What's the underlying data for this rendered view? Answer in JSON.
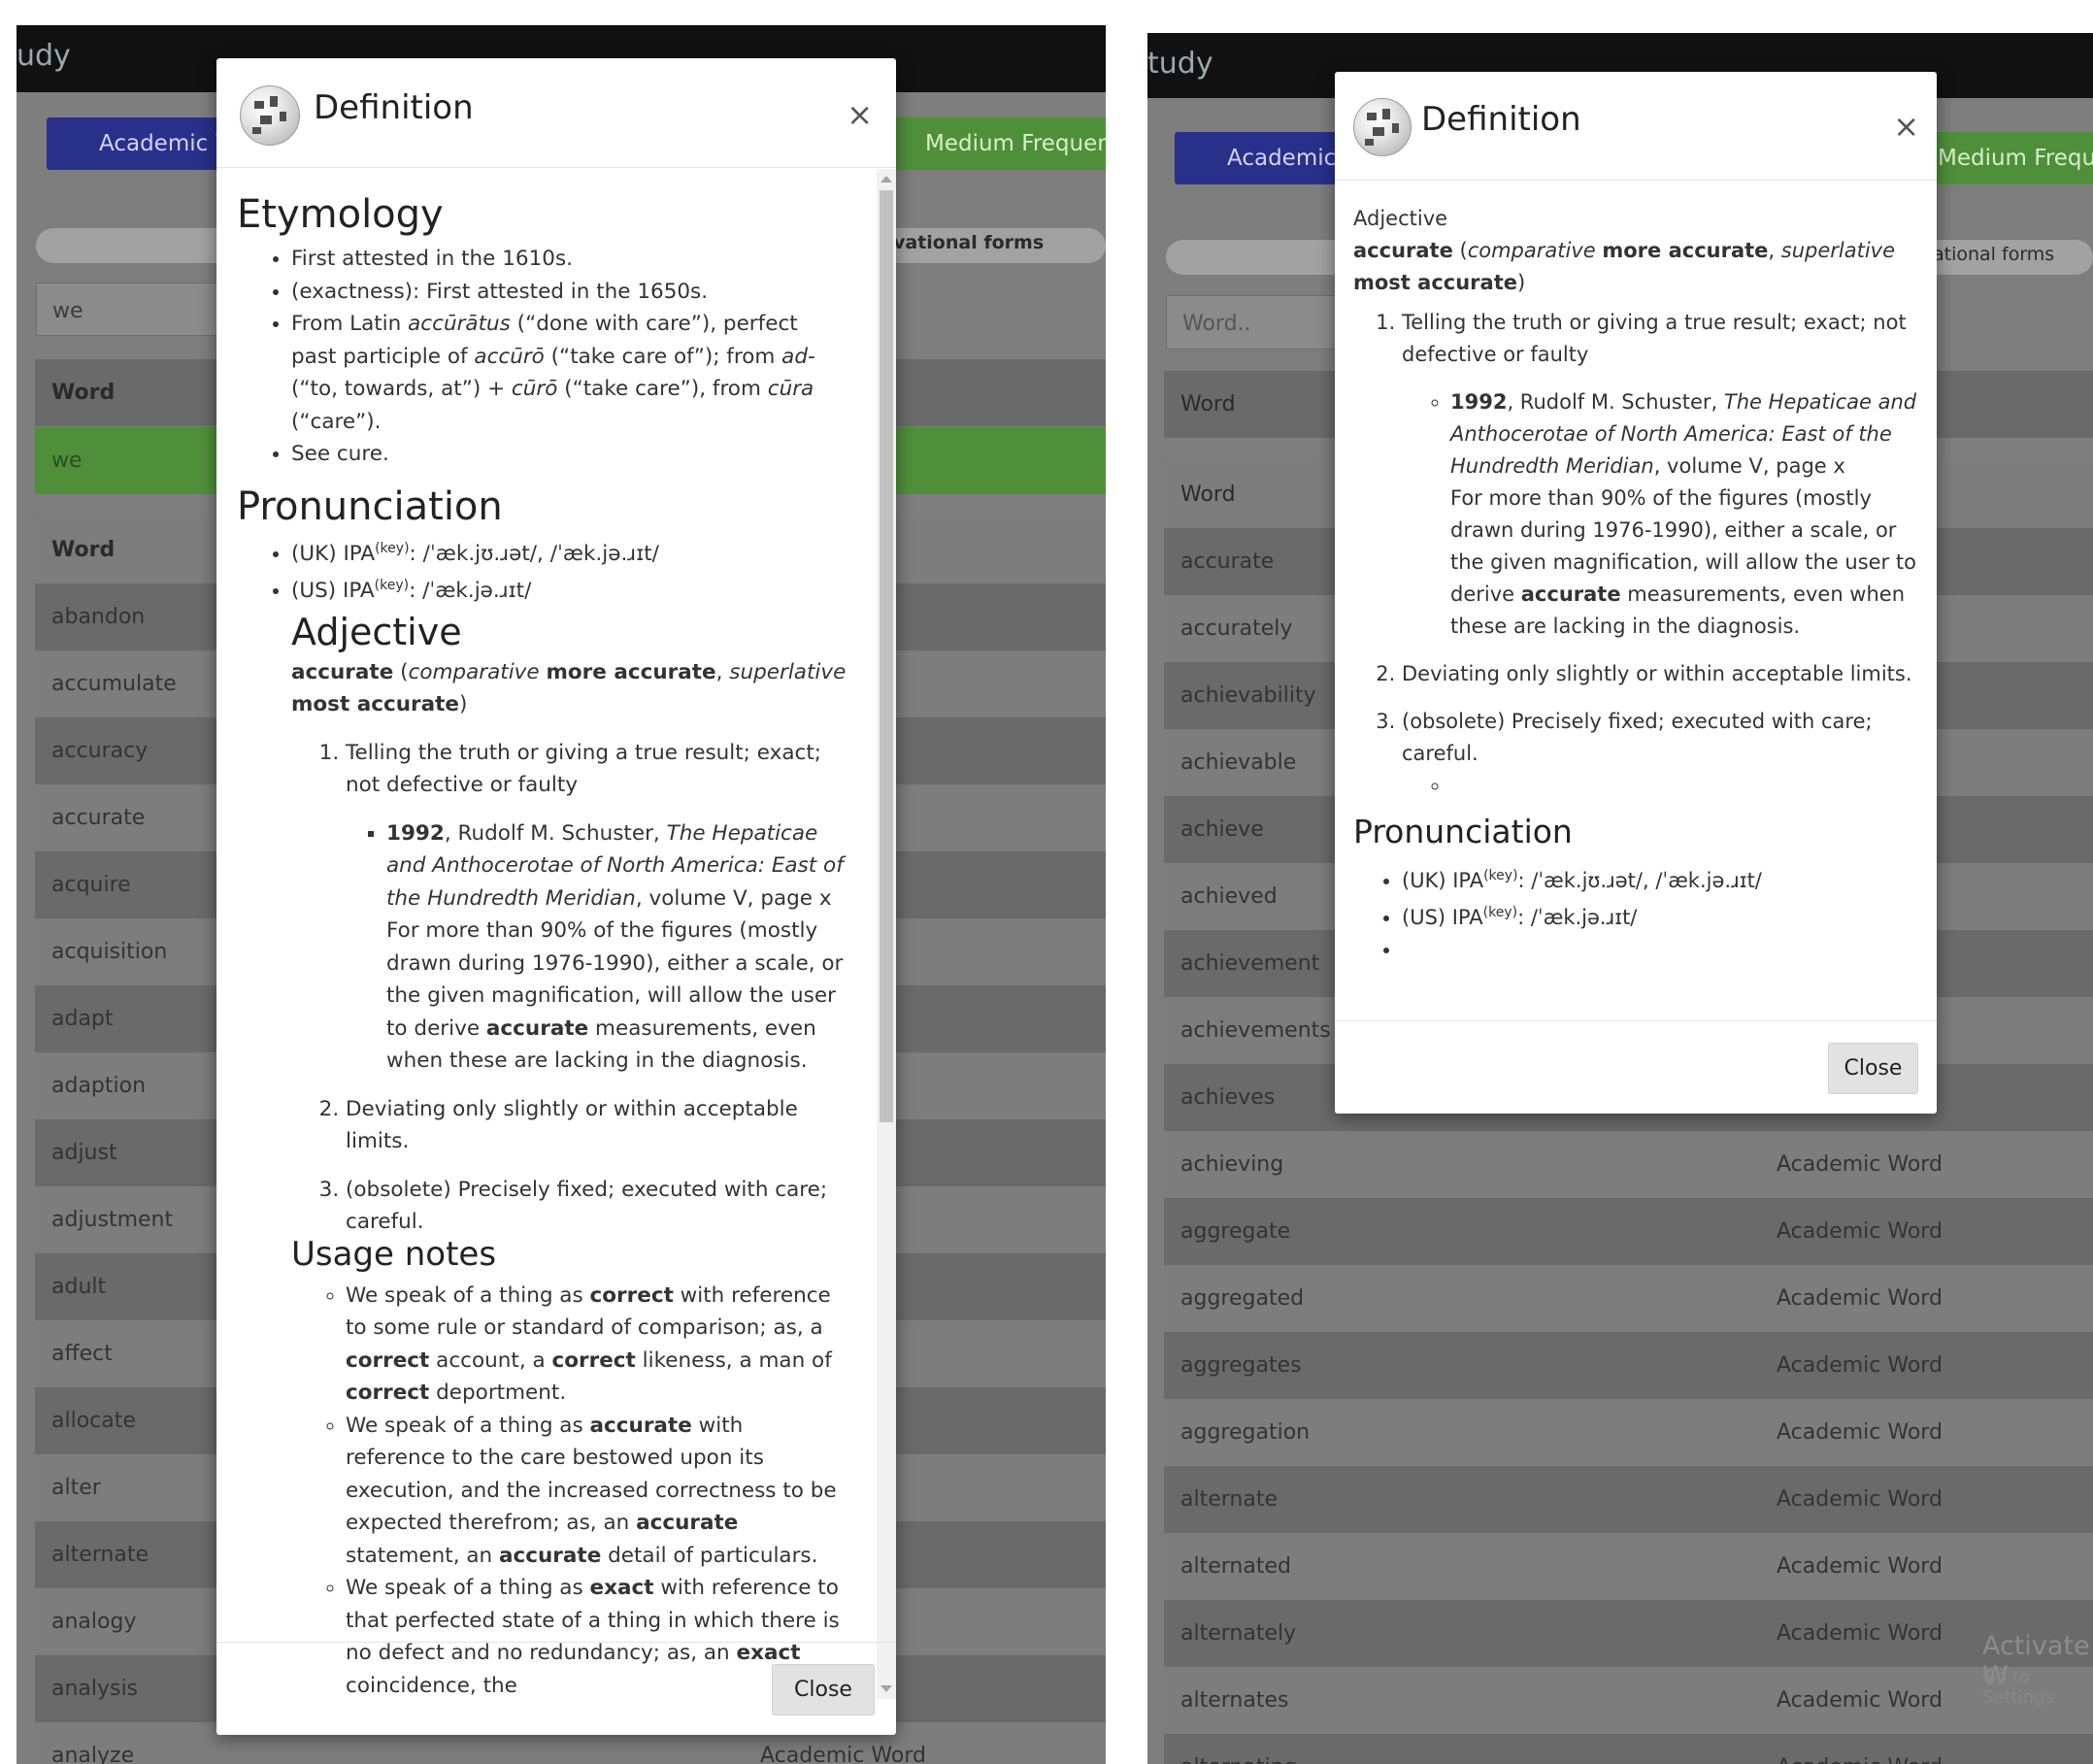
{
  "left_pane": {
    "app_title": "udy",
    "tab_label": "Academic W",
    "frequency_label": "Medium Frequency",
    "derivational_label": "vational forms",
    "search_value": "we",
    "word_header": "Word",
    "selected_word": "we",
    "list_header": "Word",
    "words": [
      "abandon",
      "accumulate",
      "accuracy",
      "accurate",
      "acquire",
      "acquisition",
      "adapt",
      "adaption",
      "adjust",
      "adjustment",
      "adult",
      "affect",
      "allocate",
      "alter",
      "alternate",
      "analogy",
      "analysis",
      "analyze"
    ],
    "last_row_type": "Academic Word"
  },
  "right_pane": {
    "app_title": "tudy",
    "tab_label": "Academic W",
    "frequency_label": "Medium Frequenc",
    "derivational_label": "ational forms",
    "search_placeholder": "Word..",
    "word_header": "Word",
    "list_header": "Word",
    "rows": [
      {
        "word": "accurate",
        "type": ""
      },
      {
        "word": "accurately",
        "type": ""
      },
      {
        "word": "achievability",
        "type": ""
      },
      {
        "word": "achievable",
        "type": ""
      },
      {
        "word": "achieve",
        "type": ""
      },
      {
        "word": "achieved",
        "type": ""
      },
      {
        "word": "achievement",
        "type": ""
      },
      {
        "word": "achievements",
        "type": ""
      },
      {
        "word": "achieves",
        "type": ""
      },
      {
        "word": "achieving",
        "type": "Academic Word"
      },
      {
        "word": "aggregate",
        "type": "Academic Word"
      },
      {
        "word": "aggregated",
        "type": "Academic Word"
      },
      {
        "word": "aggregates",
        "type": "Academic Word"
      },
      {
        "word": "aggregation",
        "type": "Academic Word"
      },
      {
        "word": "alternate",
        "type": "Academic Word"
      },
      {
        "word": "alternated",
        "type": "Academic Word"
      },
      {
        "word": "alternately",
        "type": "Academic Word"
      },
      {
        "word": "alternates",
        "type": "Academic Word"
      },
      {
        "word": "alternating",
        "type": "Academic Word"
      }
    ],
    "watermark_title": "Activate W",
    "watermark_sub": "Go to Settings"
  },
  "modal_left": {
    "title": "Definition",
    "close_x": "×",
    "close_label": "Close",
    "etymology_heading": "Etymology",
    "etymology": {
      "item1": "First attested in the 1610s.",
      "item2": "(exactness): First attested in the 1650s.",
      "item3_a": "From Latin ",
      "item3_b": "accūrātus",
      "item3_c": " (“done with care”), perfect past participle of ",
      "item3_d": "accūrō",
      "item3_e": " (“take care of”); from ",
      "item3_f": "ad-",
      "item3_g": " (“to, towards, at”) + ",
      "item3_h": "cūrō",
      "item3_i": " (“take care”), from ",
      "item3_j": "cūra",
      "item3_k": " (“care”).",
      "item4": "See cure."
    },
    "pronunciation_heading": "Pronunciation",
    "pron_uk_prefix": "(UK) IPA",
    "pron_key": "(key)",
    "pron_uk_ipa": ": /ˈæk.jʊ.ɹət/, /ˈæk.jə.ɹɪt/",
    "pron_us_prefix": "(US) IPA",
    "pron_us_ipa": ": /ˈæk.jə.ɹɪt/",
    "adjective_heading": "Adjective",
    "forms": {
      "w": "accurate",
      "p1": " (",
      "cmp": "comparative",
      "sp1": " ",
      "more": "more accurate",
      "comma": ", ",
      "sup": "superlative",
      "sp2": " ",
      "most": "most accurate",
      "p2": ")"
    },
    "sense1": "Telling the truth or giving a true result; exact; not defective or faulty",
    "quote": {
      "year": "1992",
      "author": ", Rudolf M. Schuster, ",
      "book": "The Hepaticae and Anthocerotae of North America: East of the Hundredth Meridian",
      "page": ", volume V, page x",
      "text_a": "For more than 90% of the figures (mostly drawn during 1976-1990), either a scale, or the given magnification, will allow the user to derive ",
      "text_b": "accurate",
      "text_c": " measurements, even when these are lacking in the diagnosis."
    },
    "sense2": "Deviating only slightly or within acceptable limits.",
    "sense3": "(obsolete) Precisely fixed; executed with care; careful.",
    "usage_heading": "Usage notes",
    "usage1": {
      "a": "We speak of a thing as ",
      "b": "correct",
      "c": " with reference to some rule or standard of comparison; as, a ",
      "d": "correct",
      "e": " account, a ",
      "f": "correct",
      "g": " likeness, a man of ",
      "h": "correct",
      "i": " deportment."
    },
    "usage2": {
      "a": "We speak of a thing as ",
      "b": "accurate",
      "c": " with reference to the care bestowed upon its execution, and the increased correctness to be expected therefrom; as, an ",
      "d": "accurate",
      "e": " statement, an ",
      "f": "accurate",
      "g": " detail of particulars."
    },
    "usage3": {
      "a": "We speak of a thing as ",
      "b": "exact",
      "c": " with reference to that perfected state of a thing in which there is no defect and no redundancy; as, an ",
      "d": "exact",
      "e": " coincidence, the"
    }
  },
  "modal_right": {
    "title": "Definition",
    "close_x": "×",
    "close_label": "Close",
    "pos": "Adjective",
    "forms": {
      "w": "accurate",
      "p1": " (",
      "cmp": "comparative",
      "sp1": " ",
      "more": "more accurate",
      "comma": ", ",
      "sup": "superlative",
      "sp2": " ",
      "most": "most accurate",
      "p2": ")"
    },
    "sense1": "Telling the truth or giving a true result; exact; not defective or faulty",
    "quote": {
      "year": "1992",
      "author": ", Rudolf M. Schuster, ",
      "book": "The Hepaticae and Anthocerotae of North America: East of the Hundredth Meridian",
      "page": ", volume V, page x",
      "text_a": "For more than 90% of the figures (mostly drawn during 1976-1990), either a scale, or the given magnification, will allow the user to derive ",
      "text_b": "accurate",
      "text_c": " measurements, even when these are lacking in the diagnosis."
    },
    "sense2": "Deviating only slightly or within acceptable limits.",
    "sense3": "(obsolete) Precisely fixed; executed with care; careful.",
    "pronunciation_heading": "Pronunciation",
    "pron_uk_prefix": "(UK) IPA",
    "pron_key": "(key)",
    "pron_uk_ipa": ": /ˈæk.jʊ.ɹət/, /ˈæk.jə.ɹɪt/",
    "pron_us_prefix": "(US) IPA",
    "pron_us_ipa": ": /ˈæk.jə.ɹɪt/"
  },
  "colors": {
    "topbar": "#111111",
    "tab_blue": "#28308a",
    "green": "#4f8f3a",
    "overlay_gray": "#7e7e7e"
  }
}
